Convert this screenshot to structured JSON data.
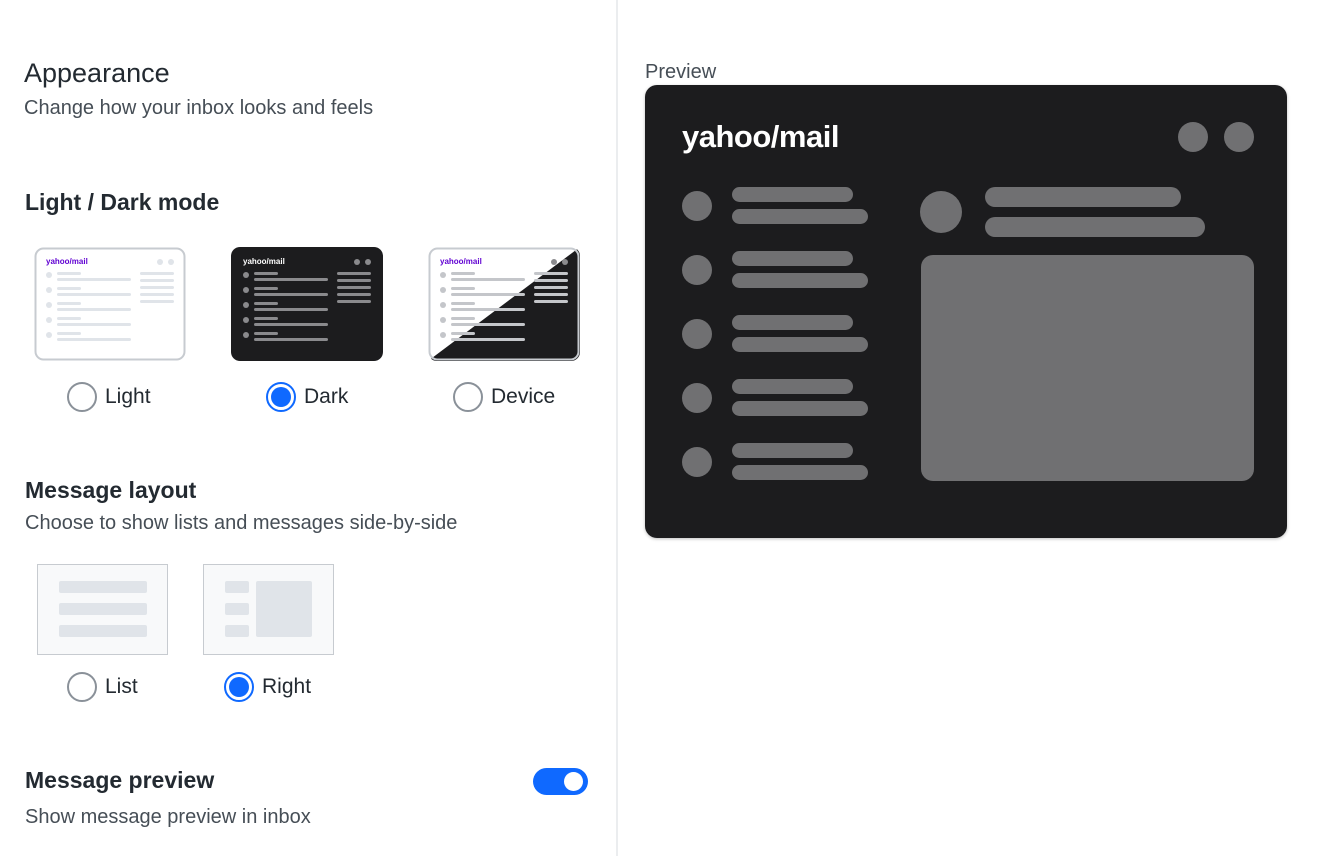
{
  "header": {
    "title": "Appearance",
    "subtitle": "Change how your inbox looks and feels"
  },
  "theme": {
    "title": "Light / Dark mode",
    "selected": "Dark",
    "options": [
      {
        "label": "Light",
        "logo": "yahoo/mail"
      },
      {
        "label": "Dark",
        "logo": "yahoo/mail"
      },
      {
        "label": "Device",
        "logo": "yahoo/mail"
      }
    ]
  },
  "layout": {
    "title": "Message layout",
    "subtitle": "Choose to show lists and messages side-by-side",
    "selected": "Right",
    "options": [
      {
        "label": "List"
      },
      {
        "label": "Right"
      }
    ]
  },
  "message_preview": {
    "title": "Message preview",
    "subtitle": "Show message preview in inbox",
    "enabled": true
  },
  "preview": {
    "label": "Preview",
    "logo": "yahoo/mail"
  },
  "colors": {
    "accent": "#0f69ff",
    "dark_bg": "#1c1c1e",
    "placeholder_gray": "#707072",
    "brand_purple": "#6001d2"
  },
  "icons": {
    "radio_unchecked": "radio-unchecked-icon",
    "radio_checked": "radio-checked-icon",
    "toggle": "toggle-switch-icon"
  }
}
